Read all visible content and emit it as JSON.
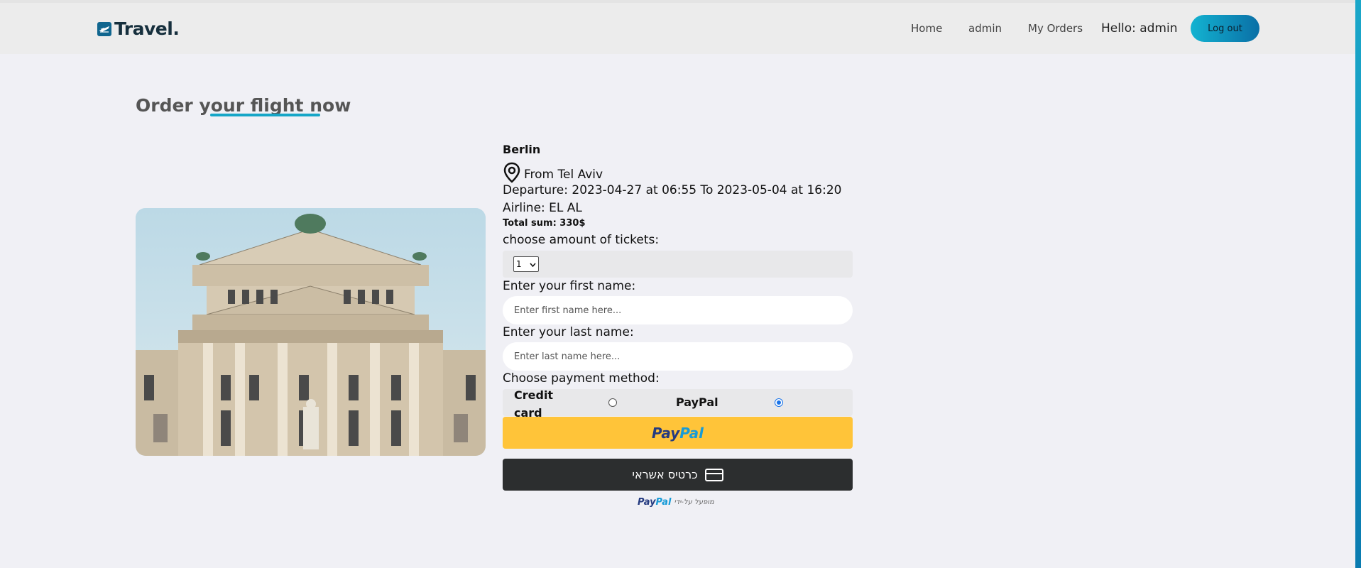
{
  "header": {
    "logo": "Travel.",
    "nav": [
      "Home",
      "admin",
      "My Orders"
    ],
    "hello": "Hello: admin",
    "logout": "Log out"
  },
  "main": {
    "title": "Order your flight now"
  },
  "flight": {
    "destination": "Berlin",
    "from": "From Tel Aviv",
    "departure": "Departure: 2023-04-27 at 06:55 To 2023-05-04 at 16:20",
    "airline": "Airline: EL AL",
    "total": "Total sum: 330$"
  },
  "form": {
    "amount_label": "choose amount of tickets:",
    "amount_value": "1",
    "first_label": "Enter your first name:",
    "first_placeholder": "Enter first name here...",
    "last_label": "Enter your last name:",
    "last_placeholder": "Enter last name here...",
    "payment_label": "Choose payment method:",
    "payment_options": [
      "Credit card",
      "PayPal"
    ],
    "payment_selected": "PayPal"
  },
  "paypal": {
    "logo_part1": "Pay",
    "logo_part2": "Pal",
    "card_button": "כרטיס אשראי",
    "powered_by": "מופעל על-ידי"
  },
  "colors": {
    "accent": "#16a6c7",
    "paypal_yellow": "#ffc439",
    "card_dark": "#2c2e2f"
  }
}
